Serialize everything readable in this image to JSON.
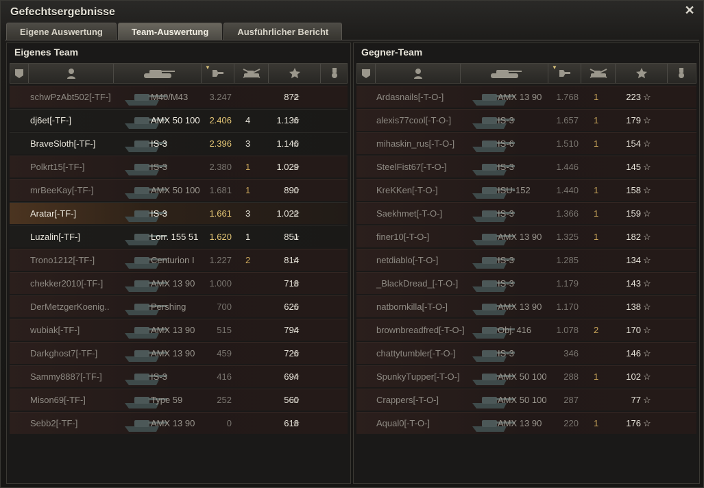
{
  "window": {
    "title": "Gefechtsergebnisse",
    "close_icon": "close-icon"
  },
  "tabs": [
    {
      "label": "Eigene Auswertung",
      "active": false
    },
    {
      "label": "Team-Auswertung",
      "active": true
    },
    {
      "label": "Ausführlicher Bericht",
      "active": false
    }
  ],
  "header_icons": [
    "squad-icon",
    "player-icon",
    "tank-icon",
    "experience-icon",
    "kills-icon",
    "damage-star-icon",
    "medal-icon"
  ],
  "colors": {
    "accent_gold": "#e4c676",
    "kills": "#c9a55a",
    "text": "#e7e4da",
    "dead_row": "#2b1f1c"
  },
  "own_team": {
    "title": "Eigenes Team",
    "rows": [
      {
        "name": "schwPzAbt502[-TF-]",
        "tank": "M40/M43",
        "xp": "3.247",
        "kills": "",
        "dmg": "872",
        "alive": false,
        "me": false
      },
      {
        "name": "dj6et[-TF-]",
        "tank": "AMX 50 100",
        "xp": "2.406",
        "kills": "4",
        "dmg": "1.136",
        "alive": true,
        "me": false
      },
      {
        "name": "BraveSloth[-TF-]",
        "tank": "IS-3",
        "xp": "2.396",
        "kills": "3",
        "dmg": "1.146",
        "alive": true,
        "me": false
      },
      {
        "name": "Polkrt15[-TF-]",
        "tank": "IS-3",
        "xp": "2.380",
        "kills": "1",
        "dmg": "1.029",
        "alive": false,
        "me": false
      },
      {
        "name": "mrBeeKay[-TF-]",
        "tank": "AMX 50 100",
        "xp": "1.681",
        "kills": "1",
        "dmg": "890",
        "alive": false,
        "me": false
      },
      {
        "name": "Aratar[-TF-]",
        "tank": "IS-3",
        "xp": "1.661",
        "kills": "3",
        "dmg": "1.022",
        "alive": true,
        "me": true
      },
      {
        "name": "Luzalin[-TF-]",
        "tank": "Lorr. 155 51",
        "xp": "1.620",
        "kills": "1",
        "dmg": "851",
        "alive": true,
        "me": false
      },
      {
        "name": "Trono1212[-TF-]",
        "tank": "Centurion I",
        "xp": "1.227",
        "kills": "2",
        "dmg": "814",
        "alive": false,
        "me": false
      },
      {
        "name": "chekker2010[-TF-]",
        "tank": "AMX 13 90",
        "xp": "1.000",
        "kills": "",
        "dmg": "718",
        "alive": false,
        "me": false
      },
      {
        "name": "DerMetzgerKoenig..",
        "tank": "Pershing",
        "xp": "700",
        "kills": "",
        "dmg": "626",
        "alive": false,
        "me": false
      },
      {
        "name": "wubiak[-TF-]",
        "tank": "AMX 13 90",
        "xp": "515",
        "kills": "",
        "dmg": "794",
        "alive": false,
        "me": false
      },
      {
        "name": "Darkghost7[-TF-]",
        "tank": "AMX 13 90",
        "xp": "459",
        "kills": "",
        "dmg": "726",
        "alive": false,
        "me": false
      },
      {
        "name": "Sammy8887[-TF-]",
        "tank": "IS-3",
        "xp": "416",
        "kills": "",
        "dmg": "694",
        "alive": false,
        "me": false
      },
      {
        "name": "Mison69[-TF-]",
        "tank": "Type 59",
        "xp": "252",
        "kills": "",
        "dmg": "560",
        "alive": false,
        "me": false
      },
      {
        "name": "Sebb2[-TF-]",
        "tank": "AMX 13 90",
        "xp": "0",
        "kills": "",
        "dmg": "618",
        "alive": false,
        "me": false
      }
    ]
  },
  "enemy_team": {
    "title": "Gegner-Team",
    "rows": [
      {
        "name": "Ardasnails[-T-O-]",
        "tank": "AMX 13 90",
        "xp": "1.768",
        "kills": "1",
        "dmg": "223",
        "alive": false
      },
      {
        "name": "alexis77cool[-T-O-]",
        "tank": "IS-3",
        "xp": "1.657",
        "kills": "1",
        "dmg": "179",
        "alive": false
      },
      {
        "name": "mihaskin_rus[-T-O-]",
        "tank": "IS-6",
        "xp": "1.510",
        "kills": "1",
        "dmg": "154",
        "alive": false
      },
      {
        "name": "SteelFist67[-T-O-]",
        "tank": "IS-3",
        "xp": "1.446",
        "kills": "",
        "dmg": "145",
        "alive": false
      },
      {
        "name": "KreKKen[-T-O-]",
        "tank": "ISU-152",
        "xp": "1.440",
        "kills": "1",
        "dmg": "158",
        "alive": false
      },
      {
        "name": "Saekhmet[-T-O-]",
        "tank": "IS-3",
        "xp": "1.366",
        "kills": "1",
        "dmg": "159",
        "alive": false
      },
      {
        "name": "finer10[-T-O-]",
        "tank": "AMX 13 90",
        "xp": "1.325",
        "kills": "1",
        "dmg": "182",
        "alive": false
      },
      {
        "name": "netdiablo[-T-O-]",
        "tank": "IS-3",
        "xp": "1.285",
        "kills": "",
        "dmg": "134",
        "alive": false
      },
      {
        "name": "_BlackDread_[-T-O-]",
        "tank": "IS-3",
        "xp": "1.179",
        "kills": "",
        "dmg": "143",
        "alive": false
      },
      {
        "name": "natbornkilla[-T-O-]",
        "tank": "AMX 13 90",
        "xp": "1.170",
        "kills": "",
        "dmg": "138",
        "alive": false
      },
      {
        "name": "brownbreadfred[-T-O-]",
        "tank": "Obj. 416",
        "xp": "1.078",
        "kills": "2",
        "dmg": "170",
        "alive": false
      },
      {
        "name": "chattytumbler[-T-O-]",
        "tank": "IS-3",
        "xp": "346",
        "kills": "",
        "dmg": "146",
        "alive": false
      },
      {
        "name": "SpunkyTupper[-T-O-]",
        "tank": "AMX 50 100",
        "xp": "288",
        "kills": "1",
        "dmg": "102",
        "alive": false
      },
      {
        "name": "Crappers[-T-O-]",
        "tank": "AMX 50 100",
        "xp": "287",
        "kills": "",
        "dmg": "77",
        "alive": false
      },
      {
        "name": "Aqual0[-T-O-]",
        "tank": "AMX 13 90",
        "xp": "220",
        "kills": "1",
        "dmg": "176",
        "alive": false
      }
    ]
  }
}
